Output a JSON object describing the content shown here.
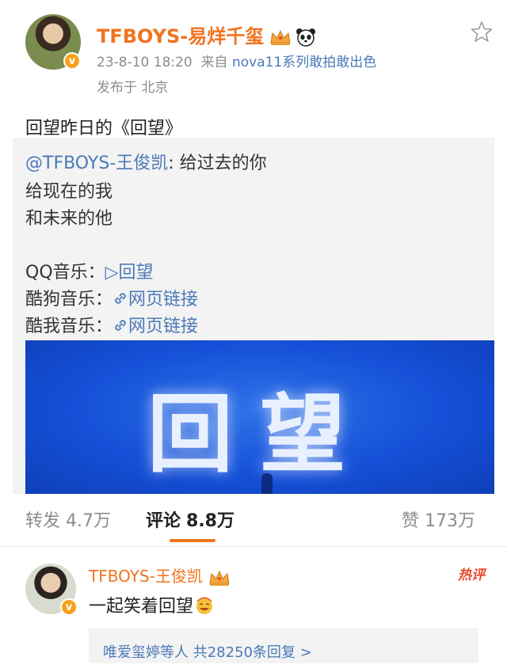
{
  "post": {
    "author": "TFBOYS-易烊千玺",
    "meta_time": "23-8-10 18:20",
    "meta_source_prefix": "来自",
    "meta_device": "nova11系列敢拍敢出色",
    "location": "发布于 北京",
    "text": "回望昨日的《回望》"
  },
  "repost": {
    "mention": "@TFBOYS-王俊凯",
    "line1_rest": ": 给过去的你",
    "line2": "给现在的我",
    "line3": "和未来的他",
    "qq_label": "QQ音乐：",
    "qq_link": "▷回望",
    "kugou_label": "酷狗音乐：",
    "kugou_link": "网页链接",
    "kuwo_label": "酷我音乐：",
    "kuwo_link": "网页链接",
    "cover_text": "回望"
  },
  "actions": {
    "repost_label": "转发",
    "repost_count": "4.7万",
    "comment_label": "评论",
    "comment_count": "8.8万",
    "like_label": "赞",
    "like_count": "173万"
  },
  "comment": {
    "author": "TFBOYS-王俊凯",
    "badge": "热评",
    "text": "一起笑着回望",
    "replies_text": "唯爱玺婷等人 共28250条回复 >"
  },
  "colors": {
    "accent": "#f0731f",
    "link": "#4a79b8",
    "cover_blue": "#1550d8"
  }
}
